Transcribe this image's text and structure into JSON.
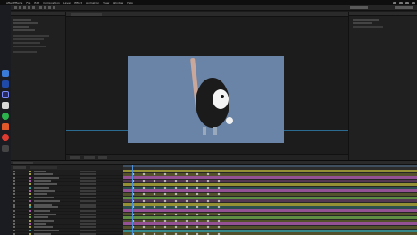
{
  "menubar": {
    "app_name": "After Effects",
    "items": [
      "File",
      "Edit",
      "Composition",
      "Layer",
      "Effect",
      "Animation",
      "View",
      "Window",
      "Help"
    ]
  },
  "colors": {
    "canvas": "#6a84a7",
    "layer_olive": "#a7a33a",
    "layer_purple": "#a85aa8",
    "layer_teal": "#3a9a9a",
    "layer_green": "#6aa04a",
    "playhead": "#4d8fd9"
  },
  "dock": {
    "icons": [
      "finder-icon",
      "chrome-icon",
      "photoshop-icon",
      "after-effects-icon",
      "app-icon",
      "spotify-icon",
      "illustrator-icon",
      "app-icon-2"
    ]
  }
}
